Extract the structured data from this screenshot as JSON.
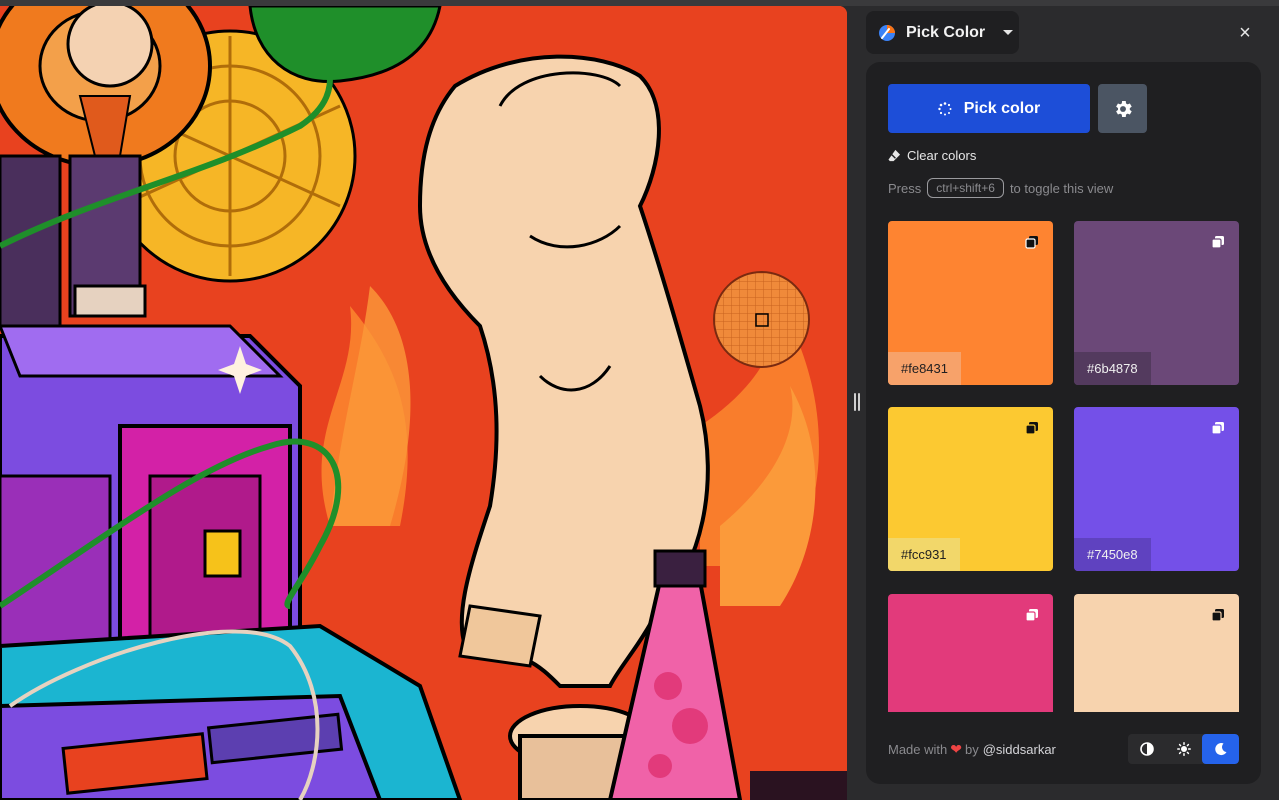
{
  "header": {
    "title": "Pick Color",
    "close_label": "×"
  },
  "actions": {
    "pick_label": "Pick color",
    "clear_label": "Clear colors"
  },
  "hint": {
    "prefix": "Press",
    "shortcut": "ctrl+shift+6",
    "suffix": "to toggle this view"
  },
  "swatches": [
    {
      "hex": "#fe8431",
      "color": "#fe8431",
      "label_bg": "#f7a26a",
      "label_color": "#1f1f21"
    },
    {
      "hex": "#6b4878",
      "color": "#6b4878",
      "label_bg": "#533a5e",
      "label_color": "#f0f0f0"
    },
    {
      "hex": "#fcc931",
      "color": "#fcc931",
      "label_bg": "#f2d76a",
      "label_color": "#1f1f21"
    },
    {
      "hex": "#7450e8",
      "color": "#7450e8",
      "label_bg": "#5f42c0",
      "label_color": "#f0f0f0"
    },
    {
      "hex": "",
      "color": "#e23a7b",
      "label_bg": "",
      "label_color": ""
    },
    {
      "hex": "",
      "color": "#f7d3ae",
      "label_bg": "",
      "label_color": ""
    }
  ],
  "footer": {
    "made_with": "Made with",
    "by": "by",
    "author": "@siddsarkar"
  },
  "theme": {
    "options": [
      "contrast-icon",
      "sun-icon",
      "moon-icon"
    ],
    "active": "moon-icon"
  },
  "colors": {
    "accent": "#1d4ed8",
    "panel": "#1f1f21",
    "background": "#2b2b2d"
  }
}
